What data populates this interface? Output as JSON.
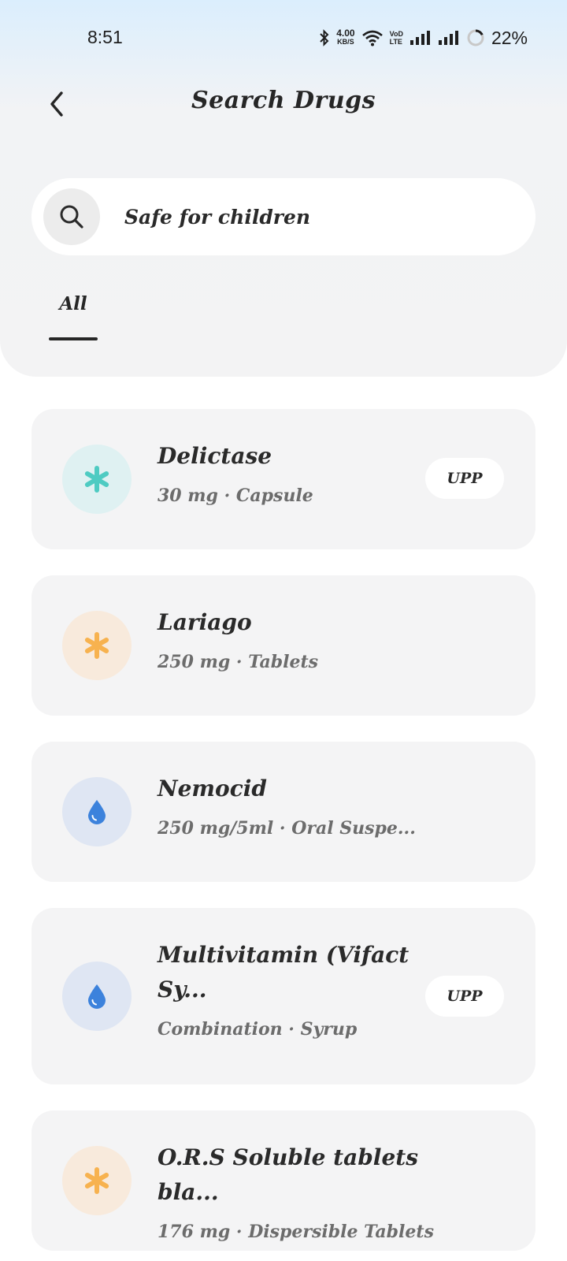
{
  "status_bar": {
    "time": "8:51",
    "net_speed_value": "4.00",
    "net_speed_unit": "KB/S",
    "volte_top": "VoD",
    "volte_bottom": "LTE",
    "battery": "22%"
  },
  "header": {
    "title": "Search Drugs"
  },
  "search": {
    "value": "Safe for children"
  },
  "tabs": [
    {
      "label": "All",
      "selected": true
    }
  ],
  "drugs": [
    {
      "name": "Delictase",
      "detail": "30 mg · Capsule",
      "badge": "UPP",
      "icon": "asterisk-icon",
      "icon_color": "#4ecbc2",
      "icon_bg": "#dff1f2"
    },
    {
      "name": "Lariago",
      "detail": "250 mg · Tablets",
      "badge": "",
      "icon": "asterisk-icon",
      "icon_color": "#f7b24f",
      "icon_bg": "#f8eadc"
    },
    {
      "name": "Nemocid",
      "detail": "250 mg/5ml · Oral Suspe...",
      "badge": "",
      "icon": "droplet-icon",
      "icon_color": "#3c82dc",
      "icon_bg": "#dfe6f3"
    },
    {
      "name": "Multivitamin (Vifact\nSy...",
      "detail": "Combination · Syrup",
      "badge": "UPP",
      "icon": "droplet-icon",
      "icon_color": "#3c82dc",
      "icon_bg": "#dfe6f3"
    },
    {
      "name": "O.R.S Soluble tablets bla...",
      "detail": "176 mg · Dispersible Tablets",
      "badge": "",
      "icon": "asterisk-icon",
      "icon_color": "#f7b24f",
      "icon_bg": "#f8eadc"
    }
  ]
}
